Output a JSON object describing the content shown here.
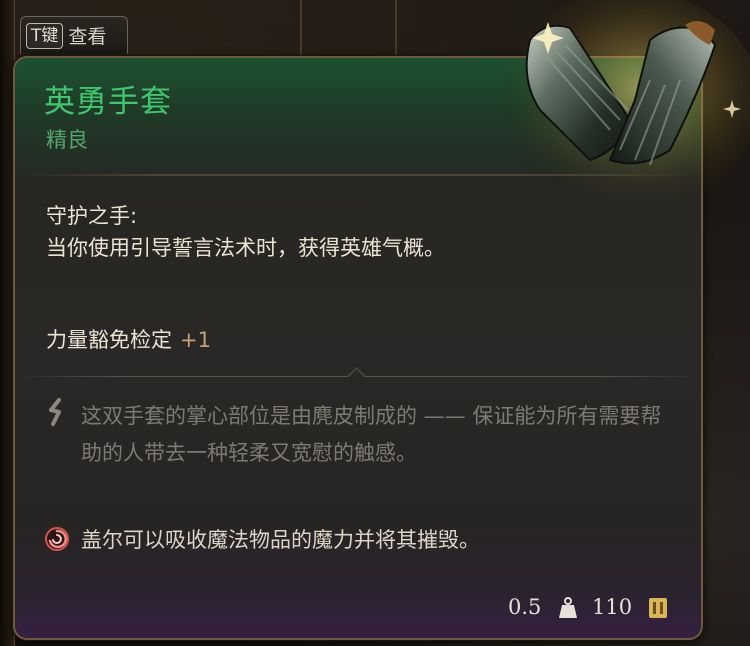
{
  "hotkey": {
    "key": "T键",
    "label": "查看"
  },
  "item": {
    "name": "英勇手套",
    "rarity": "精良",
    "ability_name": "守护之手:",
    "ability_description": "当你使用引导誓言法术时，获得英雄气概。",
    "stat_label": "力量豁免检定",
    "stat_value": "+1",
    "lore": "这双手套的掌心部位是由麂皮制成的 —— 保证能为所有需要帮助的人带去一种轻柔又宽慰的触感。",
    "note": "盖尔可以吸收魔法物品的魔力并将其摧毁。",
    "weight": "0.5",
    "value": "110"
  },
  "icons": {
    "lore": "feather-quill-icon",
    "note": "arcane-swirl-icon",
    "weight": "weight-icon",
    "gold": "gold-coin-icon",
    "item_art": "gauntlet-icon"
  },
  "colors": {
    "title": "#40c66f",
    "rarity": "#55a66f",
    "body_text": "#ebe4d4",
    "stat_value": "#c8a173",
    "lore_text": "#7d7a73",
    "frame": "#6e5a3e",
    "note_icon": "#d9534f"
  }
}
